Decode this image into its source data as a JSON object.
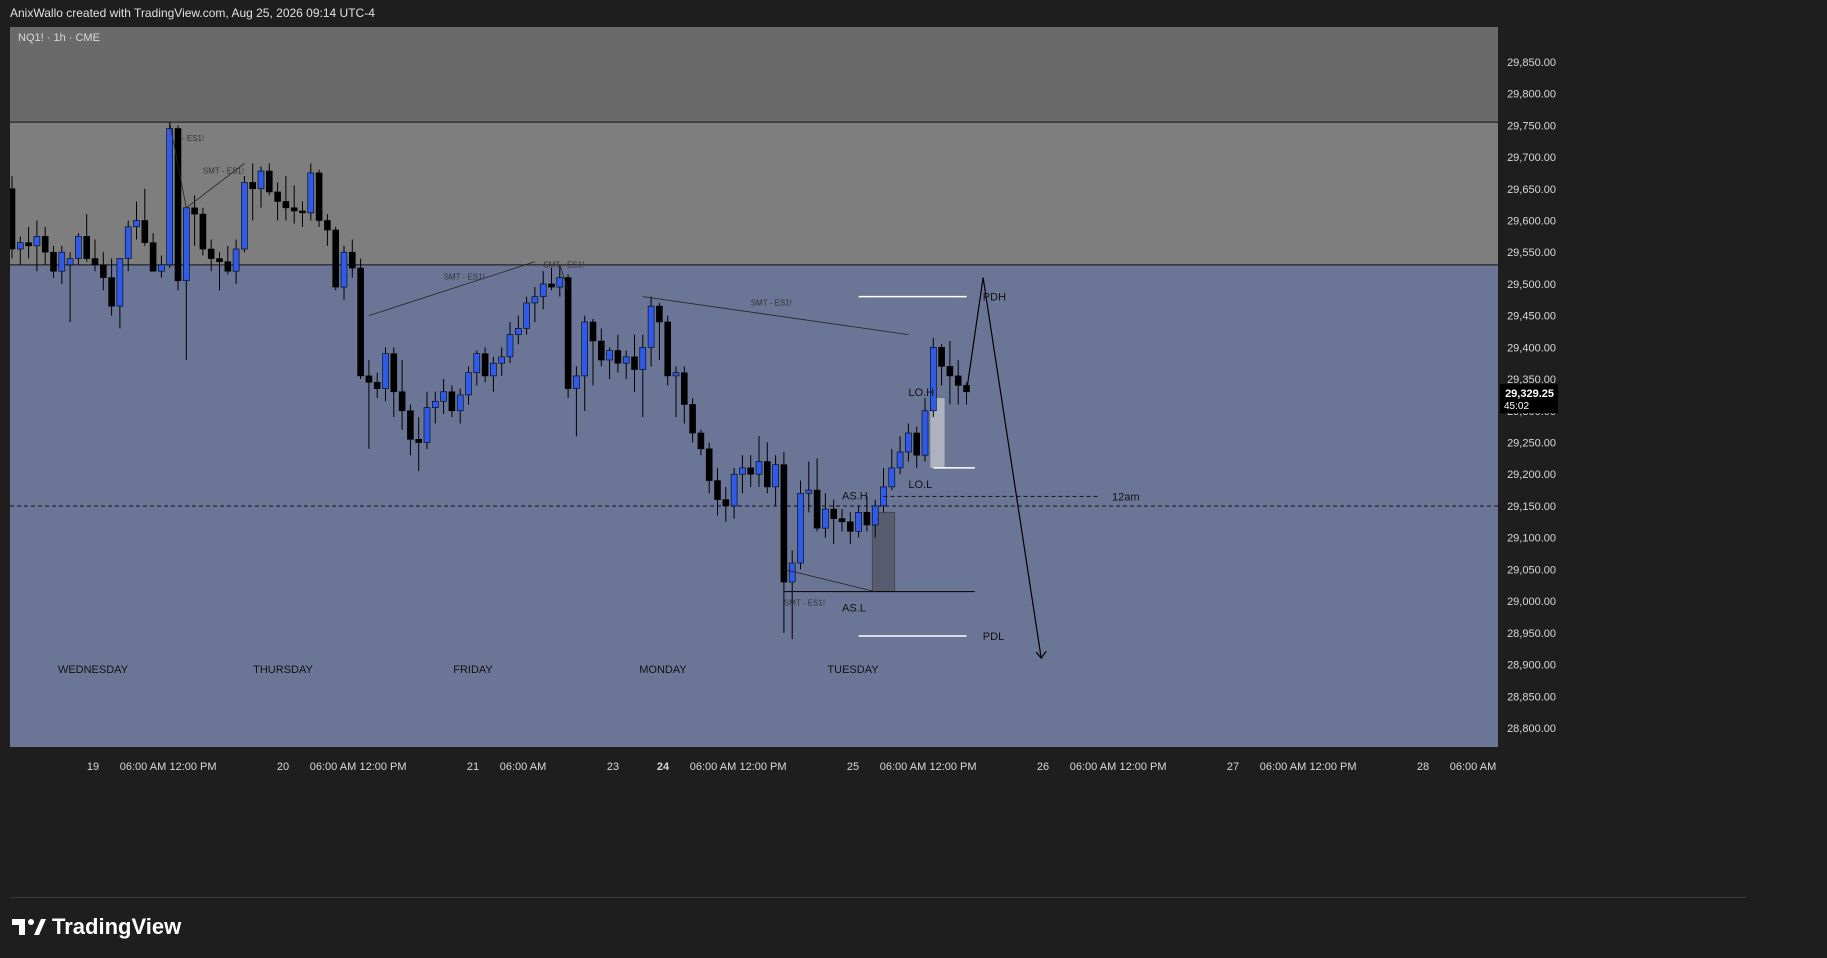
{
  "header": {
    "caption": "AnixWallo created with TradingView.com, Aug 25, 2026 09:14 UTC-4"
  },
  "branding": {
    "name": "TradingView"
  },
  "colors": {
    "premium_zone": "#6a6a6a",
    "range_zone": "#7e7e7e",
    "discount_zone": "#6b7696",
    "bull_candle": "#2f5be8",
    "bear_candle": "#000000",
    "price_label_bg": "#000000"
  },
  "chart_data": {
    "type": "candlestick",
    "symbol_label": "NQ1! · 1h · CME",
    "price_axis": [
      "29,850.00",
      "29,800.00",
      "29,750.00",
      "29,700.00",
      "29,650.00",
      "29,600.00",
      "29,550.00",
      "29,500.00",
      "29,450.00",
      "29,400.00",
      "29,350.00",
      "29,300.00",
      "29,250.00",
      "29,200.00",
      "29,150.00",
      "29,100.00",
      "29,050.00",
      "29,000.00",
      "28,950.00",
      "28,900.00",
      "28,850.00",
      "28,800.00"
    ],
    "ylim": [
      28770,
      29905
    ],
    "time_axis": [
      "19",
      "06:00 AM",
      "12:00 PM",
      "20",
      "06:00 AM",
      "12:00 PM",
      "21",
      "06:00 AM",
      "23",
      "24",
      "06:00 AM",
      "12:00 PM",
      "25",
      "06:00 AM",
      "12:00 PM",
      "26",
      "06:00 AM",
      "12:00 PM",
      "27",
      "06:00 AM",
      "12:00 PM",
      "28",
      "06:00 AM"
    ],
    "day_labels": [
      "WEDNESDAY",
      "THURSDAY",
      "FRIDAY",
      "MONDAY",
      "TUESDAY"
    ],
    "current_price": "29,329.25",
    "countdown": "45:02",
    "levels": {
      "zone_upper": 29755,
      "zone_lower": 29530,
      "midnight_open": 29150,
      "pdh": 29480,
      "pdl": 28945,
      "asia_low": 29015,
      "midnight_level_short": 29165
    },
    "labels": {
      "smt": "SMT - ES1!",
      "smt_short": "- ES1!",
      "pdh": "PDH",
      "pdl": "PDL",
      "asia_high": "AS.H",
      "asia_low": "AS.L",
      "london_high": "LO.H",
      "london_low": "LO.L",
      "midnight": "12am"
    },
    "projection": [
      [
        29330,
        29510
      ],
      [
        29510,
        28910
      ]
    ],
    "candles": [
      [
        29650,
        29670,
        29540,
        29555
      ],
      [
        29555,
        29575,
        29530,
        29565
      ],
      [
        29565,
        29590,
        29540,
        29560
      ],
      [
        29560,
        29600,
        29520,
        29575
      ],
      [
        29575,
        29590,
        29530,
        29550
      ],
      [
        29550,
        29560,
        29510,
        29520
      ],
      [
        29520,
        29560,
        29500,
        29550
      ],
      [
        29530,
        29550,
        29440,
        29540
      ],
      [
        29540,
        29580,
        29530,
        29575
      ],
      [
        29575,
        29610,
        29535,
        29540
      ],
      [
        29540,
        29570,
        29520,
        29530
      ],
      [
        29530,
        29550,
        29490,
        29510
      ],
      [
        29510,
        29540,
        29450,
        29465
      ],
      [
        29465,
        29540,
        29430,
        29540
      ],
      [
        29540,
        29600,
        29520,
        29590
      ],
      [
        29590,
        29630,
        29570,
        29600
      ],
      [
        29600,
        29650,
        29560,
        29565
      ],
      [
        29565,
        29580,
        29520,
        29520
      ],
      [
        29520,
        29545,
        29510,
        29530
      ],
      [
        29530,
        29755,
        29525,
        29745
      ],
      [
        29745,
        29750,
        29490,
        29505
      ],
      [
        29505,
        29590,
        29380,
        29620
      ],
      [
        29620,
        29640,
        29560,
        29610
      ],
      [
        29610,
        29620,
        29545,
        29555
      ],
      [
        29555,
        29570,
        29520,
        29540
      ],
      [
        29540,
        29550,
        29490,
        29535
      ],
      [
        29535,
        29560,
        29515,
        29520
      ],
      [
        29520,
        29570,
        29500,
        29555
      ],
      [
        29555,
        29670,
        29550,
        29660
      ],
      [
        29660,
        29690,
        29600,
        29650
      ],
      [
        29650,
        29685,
        29620,
        29678
      ],
      [
        29678,
        29690,
        29640,
        29645
      ],
      [
        29645,
        29660,
        29600,
        29630
      ],
      [
        29630,
        29670,
        29600,
        29620
      ],
      [
        29620,
        29655,
        29595,
        29615
      ],
      [
        29615,
        29630,
        29590,
        29612
      ],
      [
        29612,
        29690,
        29600,
        29675
      ],
      [
        29675,
        29680,
        29590,
        29600
      ],
      [
        29600,
        29610,
        29560,
        29585
      ],
      [
        29585,
        29590,
        29490,
        29495
      ],
      [
        29495,
        29560,
        29475,
        29550
      ],
      [
        29550,
        29570,
        29510,
        29525
      ],
      [
        29525,
        29540,
        29350,
        29355
      ],
      [
        29355,
        29380,
        29240,
        29345
      ],
      [
        29345,
        29360,
        29320,
        29335
      ],
      [
        29335,
        29400,
        29315,
        29390
      ],
      [
        29390,
        29400,
        29290,
        29330
      ],
      [
        29330,
        29380,
        29270,
        29300
      ],
      [
        29300,
        29310,
        29230,
        29255
      ],
      [
        29255,
        29290,
        29205,
        29250
      ],
      [
        29250,
        29330,
        29240,
        29305
      ],
      [
        29305,
        29330,
        29280,
        29315
      ],
      [
        29315,
        29350,
        29295,
        29330
      ],
      [
        29330,
        29340,
        29290,
        29300
      ],
      [
        29300,
        29335,
        29280,
        29325
      ],
      [
        29325,
        29370,
        29310,
        29360
      ],
      [
        29360,
        29395,
        29340,
        29390
      ],
      [
        29390,
        29400,
        29345,
        29355
      ],
      [
        29355,
        29385,
        29330,
        29375
      ],
      [
        29375,
        29400,
        29355,
        29385
      ],
      [
        29385,
        29440,
        29375,
        29420
      ],
      [
        29420,
        29450,
        29405,
        29430
      ],
      [
        29430,
        29480,
        29420,
        29470
      ],
      [
        29470,
        29495,
        29440,
        29480
      ],
      [
        29480,
        29520,
        29460,
        29500
      ],
      [
        29500,
        29525,
        29490,
        29495
      ],
      [
        29495,
        29530,
        29480,
        29510
      ],
      [
        29510,
        29515,
        29320,
        29335
      ],
      [
        29335,
        29370,
        29260,
        29355
      ],
      [
        29355,
        29450,
        29300,
        29440
      ],
      [
        29440,
        29445,
        29340,
        29410
      ],
      [
        29410,
        29430,
        29370,
        29380
      ],
      [
        29380,
        29400,
        29350,
        29395
      ],
      [
        29395,
        29420,
        29360,
        29375
      ],
      [
        29375,
        29395,
        29350,
        29385
      ],
      [
        29385,
        29420,
        29330,
        29365
      ],
      [
        29365,
        29420,
        29290,
        29400
      ],
      [
        29400,
        29480,
        29370,
        29465
      ],
      [
        29465,
        29470,
        29380,
        29440
      ],
      [
        29440,
        29450,
        29340,
        29355
      ],
      [
        29355,
        29370,
        29290,
        29360
      ],
      [
        29360,
        29370,
        29280,
        29310
      ],
      [
        29310,
        29320,
        29250,
        29265
      ],
      [
        29265,
        29270,
        29230,
        29240
      ],
      [
        29240,
        29250,
        29170,
        29190
      ],
      [
        29190,
        29210,
        29135,
        29160
      ],
      [
        29160,
        29180,
        29125,
        29150
      ],
      [
        29150,
        29210,
        29130,
        29200
      ],
      [
        29200,
        29230,
        29170,
        29210
      ],
      [
        29210,
        29230,
        29180,
        29200
      ],
      [
        29200,
        29260,
        29180,
        29220
      ],
      [
        29220,
        29250,
        29170,
        29180
      ],
      [
        29180,
        29230,
        29150,
        29215
      ],
      [
        29215,
        29235,
        28950,
        29030
      ],
      [
        29030,
        29080,
        28940,
        29060
      ],
      [
        29060,
        29190,
        29050,
        29170
      ],
      [
        29170,
        29220,
        29140,
        29175
      ],
      [
        29175,
        29225,
        29110,
        29115
      ],
      [
        29115,
        29170,
        29100,
        29145
      ],
      [
        29145,
        29160,
        29090,
        29130
      ],
      [
        29130,
        29145,
        29110,
        29125
      ],
      [
        29125,
        29140,
        29090,
        29110
      ],
      [
        29110,
        29150,
        29100,
        29140
      ],
      [
        29140,
        29165,
        29110,
        29120
      ],
      [
        29120,
        29160,
        29100,
        29150
      ],
      [
        29150,
        29210,
        29140,
        29180
      ],
      [
        29180,
        29240,
        29175,
        29210
      ],
      [
        29210,
        29260,
        29200,
        29235
      ],
      [
        29235,
        29280,
        29220,
        29265
      ],
      [
        29265,
        29275,
        29210,
        29230
      ],
      [
        29230,
        29320,
        29220,
        29300
      ],
      [
        29300,
        29415,
        29290,
        29400
      ],
      [
        29400,
        29405,
        29340,
        29370
      ],
      [
        29370,
        29410,
        29310,
        29355
      ],
      [
        29355,
        29380,
        29310,
        29340
      ],
      [
        29340,
        29345,
        29310,
        29330
      ]
    ]
  }
}
